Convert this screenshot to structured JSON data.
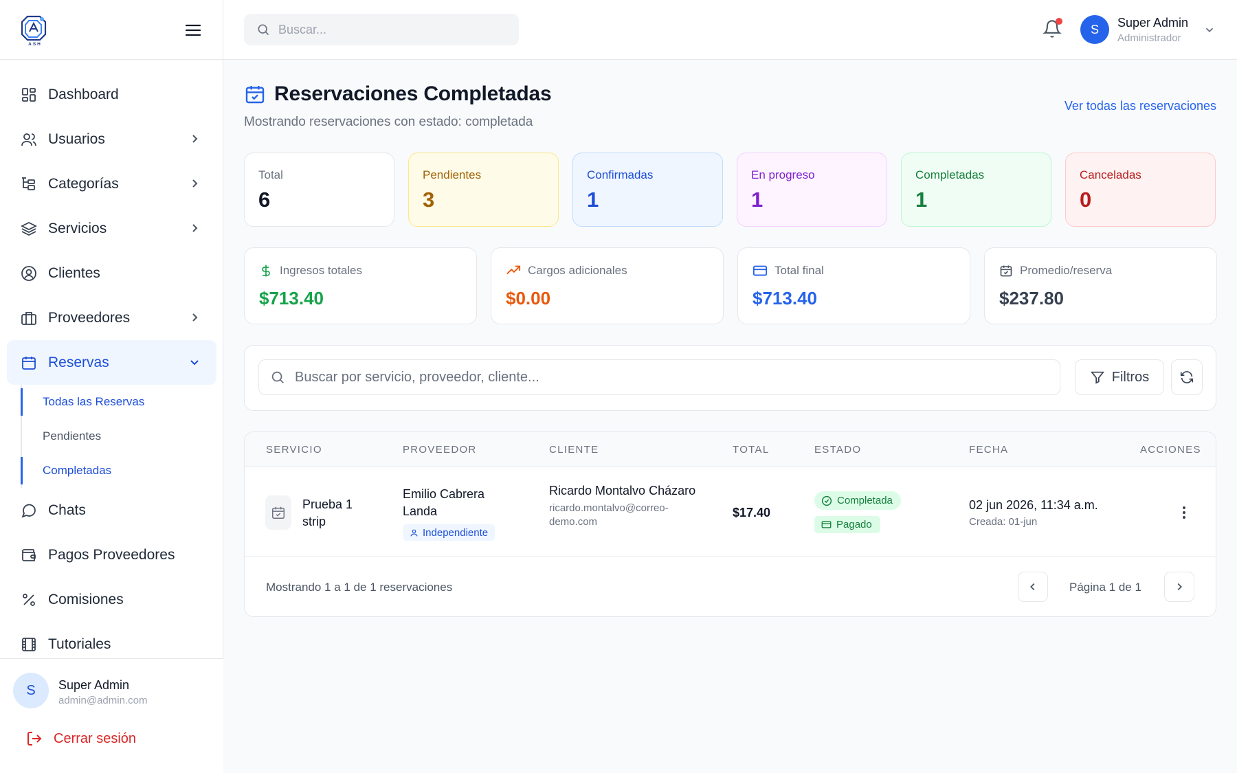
{
  "app": {
    "logo_name": "ASH"
  },
  "topbar": {
    "search_placeholder": "Buscar...",
    "user_name": "Super Admin",
    "user_role": "Administrador",
    "avatar_letter": "S",
    "has_notifications": true
  },
  "sidebar": {
    "items": [
      {
        "label": "Dashboard",
        "icon": "grid-icon"
      },
      {
        "label": "Usuarios",
        "icon": "users-icon",
        "has_children": true
      },
      {
        "label": "Categorías",
        "icon": "category-tree-icon",
        "has_children": true
      },
      {
        "label": "Servicios",
        "icon": "layers-icon",
        "has_children": true
      },
      {
        "label": "Clientes",
        "icon": "user-circle-icon"
      },
      {
        "label": "Proveedores",
        "icon": "briefcase-icon",
        "has_children": true
      },
      {
        "label": "Reservas",
        "icon": "calendar-icon",
        "has_children": true,
        "expanded": true,
        "active": true
      },
      {
        "label": "Chats",
        "icon": "chat-bubble-icon"
      },
      {
        "label": "Pagos Proveedores",
        "icon": "wallet-icon"
      },
      {
        "label": "Comisiones",
        "icon": "percent-icon"
      },
      {
        "label": "Tutoriales",
        "icon": "film-icon"
      }
    ],
    "reservas_sub": [
      {
        "label": "Todas las Reservas",
        "active": true
      },
      {
        "label": "Pendientes",
        "active": false
      },
      {
        "label": "Completadas",
        "active": true
      }
    ],
    "footer": {
      "avatar_letter": "S",
      "name": "Super Admin",
      "email": "admin@admin.com",
      "logout_label": "Cerrar sesión"
    }
  },
  "page": {
    "title": "Reservaciones Completadas",
    "subtitle": "Mostrando reservaciones con estado: completada",
    "view_all_link": "Ver todas las reservaciones"
  },
  "stats": [
    {
      "label": "Total",
      "value": "6"
    },
    {
      "label": "Pendientes",
      "value": "3"
    },
    {
      "label": "Confirmadas",
      "value": "1"
    },
    {
      "label": "En progreso",
      "value": "1"
    },
    {
      "label": "Completadas",
      "value": "1"
    },
    {
      "label": "Canceladas",
      "value": "0"
    }
  ],
  "money": [
    {
      "label": "Ingresos totales",
      "value": "$713.40",
      "icon": "dollar-icon",
      "color": "#16a34a"
    },
    {
      "label": "Cargos adicionales",
      "value": "$0.00",
      "icon": "trending-up-icon",
      "color": "#ea580c"
    },
    {
      "label": "Total final",
      "value": "$713.40",
      "icon": "credit-card-icon",
      "color": "#2563eb"
    },
    {
      "label": "Promedio/reserva",
      "value": "$237.80",
      "icon": "calendar-check-icon",
      "color": "#374151"
    }
  ],
  "filters": {
    "search_placeholder": "Buscar por servicio, proveedor, cliente...",
    "filters_label": "Filtros"
  },
  "table": {
    "columns": [
      "SERVICIO",
      "PROVEEDOR",
      "CLIENTE",
      "TOTAL",
      "ESTADO",
      "FECHA",
      "ACCIONES"
    ],
    "rows": [
      {
        "service": "Prueba 1 strip",
        "provider": "Emilio Cabrera Landa",
        "provider_tag": "Independiente",
        "client_name": "Ricardo Montalvo Cházaro",
        "client_email": "ricardo.montalvo@correo-demo.com",
        "total": "$17.40",
        "status": "Completada",
        "payment": "Pagado",
        "date": "02 jun 2026, 11:34 a.m.",
        "created": "Creada: 01-jun"
      }
    ],
    "footer_text": "Mostrando 1 a 1 de 1 reservaciones",
    "page_text": "Página 1 de 1"
  }
}
